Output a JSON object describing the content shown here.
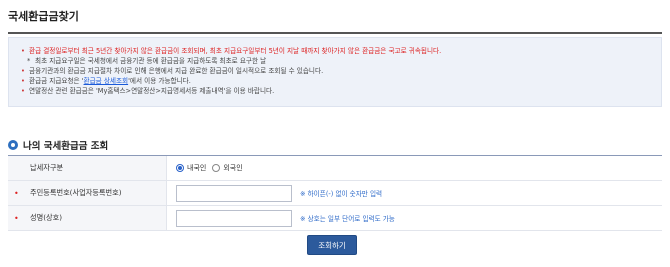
{
  "page": {
    "title": "국세환급금찾기"
  },
  "notice": {
    "line1": "환급 결정일로부터 최근 5년간 찾아가지 않은 환급금이 조회되며, 최초 지급요구일부터 5년이 지날 때까지 찾아가지 않은 환급금은 국고로 귀속됩니다.",
    "line1_sub": "최초 지급요구일은 국세청에서 금융기관 등에 환급금을 지급하도록 최초로 요구한 날",
    "line2": "금융기관과의 환급금 지급절차 차이로 인해 은행에서 지급 완료한 환급금이 일시적으로 조회될 수 있습니다.",
    "line3_prefix": "환급금 지급요청은 '",
    "line3_link": "환급금 상세조회",
    "line3_suffix": "'에서 이용 가능합니다.",
    "line4": "연말정산 관련 환급금은 'My홈택스>연말정산>지급명세서등 제출내역'을 이용 바랍니다."
  },
  "section": {
    "title": "나의 국세환급금 조회"
  },
  "form": {
    "taxpayer_type": {
      "label": "납세자구분",
      "options": [
        "내국인",
        "외국인"
      ],
      "selected": "내국인"
    },
    "id_number": {
      "label": "주민등록번호(사업자등록번호)",
      "value": "",
      "hint": "※ 하이픈(-) 없이 숫자만 입력"
    },
    "name": {
      "label": "성명(상호)",
      "value": "",
      "hint": "※ 상호는 일부 단어로 입력도 가능"
    }
  },
  "actions": {
    "search_label": "조회하기"
  },
  "colors": {
    "accent": "#2c5a9c",
    "required": "#d22222",
    "hint": "#2f6bc9",
    "notice_bg": "#eef2f9"
  }
}
